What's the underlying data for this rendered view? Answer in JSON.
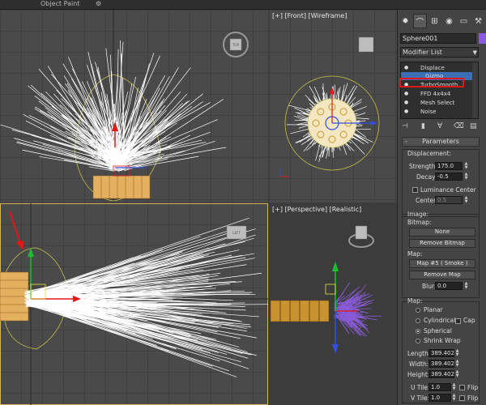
{
  "menu": {
    "item_a": "Object Paint",
    "item_b": "⚙"
  },
  "viewports": {
    "front_label": "[+] [Front] [Wireframe]",
    "perspective_label": "[+] [Perspective] [Realistic]",
    "cube_top": "TOP",
    "cube_left": "LEFT"
  },
  "panel": {
    "object_name": "Sphere001",
    "color_swatch": "#8c5ae0",
    "modifier_list": "Modifier List",
    "stack": [
      "Displace",
      "Gizmo",
      "TurboSmooth",
      "FFD 4x4x4",
      "Mesh Select",
      "Noise"
    ],
    "parameters_title": "Parameters",
    "displacement_label": "Displacement:",
    "strength_label": "Strength:",
    "strength_value": "175.0",
    "decay_label": "Decay:",
    "decay_value": "-0.5",
    "luminance_center_label": "Luminance Center",
    "center_label": "Center:",
    "center_value": "0.5",
    "image_label": "Image:",
    "bitmap_label": "Bitmap:",
    "bitmap_button": "None",
    "remove_bitmap_button": "Remove Bitmap",
    "map_label": "Map:",
    "map_button": "Map #5  ( Smoke )",
    "remove_map_button": "Remove Map",
    "blur_label": "Blur:",
    "blur_value": "0.0",
    "map_type_label": "Map:",
    "planar_label": "Planar",
    "cylindrical_label": "Cylindrical",
    "cap_label": "Cap",
    "spherical_label": "Spherical",
    "shrink_wrap_label": "Shrink Wrap",
    "length_label": "Length:",
    "length_value": "389.402",
    "width_label": "Width:",
    "width_value": "389.402",
    "height_label": "Height:",
    "height_value": "389.402",
    "utile_label": "U Tile:",
    "utile_value": "1.0",
    "vtile_label": "V Tile:",
    "vtile_value": "1.0",
    "flip_label": "Flip"
  },
  "colors": {
    "selection": "#3b6fb4",
    "highlight_box": "#e01818",
    "accent_arrow": "#e01818"
  }
}
